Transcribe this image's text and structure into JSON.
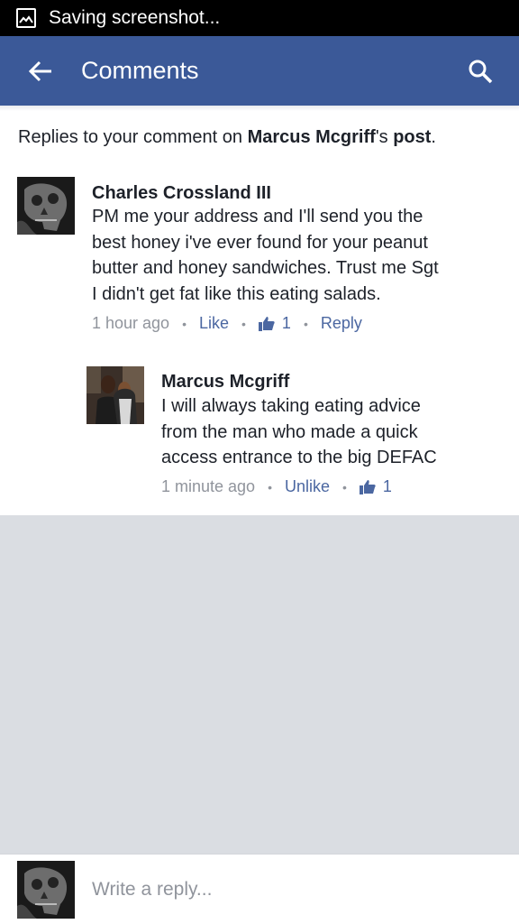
{
  "status_bar": {
    "text": "Saving screenshot..."
  },
  "app_bar": {
    "title": "Comments",
    "back_icon": "arrow-left-icon",
    "search_icon": "search-icon",
    "color": "#3b5998"
  },
  "context": {
    "prefix": "Replies to your comment on ",
    "author": "Marcus Mcgriff",
    "suffix": "'s ",
    "post": "post",
    "end": "."
  },
  "comments": [
    {
      "name": "Charles Crossland III",
      "lines": [
        "PM me your address and I'll send you the",
        "best honey i've ever found for your peanut",
        "butter and honey sandwiches. Trust me Sgt",
        "I didn't get fat like this eating salads."
      ],
      "time": "1 hour ago",
      "action": "Like",
      "likes": "1",
      "reply": "Reply"
    },
    {
      "name": "Marcus Mcgriff",
      "lines": [
        "I will always taking eating advice",
        "from the man who made a quick",
        "access entrance to the big DEFAC"
      ],
      "time": "1 minute ago",
      "action": "Unlike",
      "likes": "1"
    }
  ],
  "reply_bar": {
    "placeholder": "Write a reply..."
  }
}
